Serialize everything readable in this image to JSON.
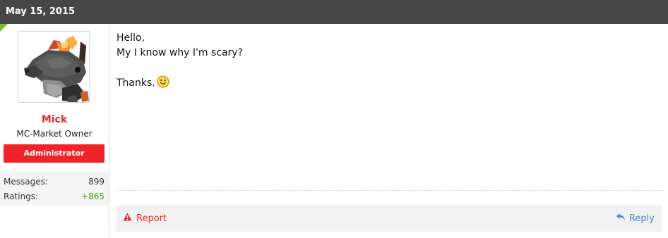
{
  "post": {
    "date": "May 15, 2015"
  },
  "user": {
    "name": "Mick",
    "title": "MC-Market Owner",
    "badge": "Administrator",
    "stats": [
      {
        "label": "Messages:",
        "value": "899"
      },
      {
        "label": "Ratings:",
        "value": "+865"
      }
    ]
  },
  "message": {
    "lines": [
      "Hello,",
      "My I know why I'm scary?",
      "",
      "Thanks."
    ],
    "emoji": "smile-icon"
  },
  "footer": {
    "report_label": "Report",
    "reply_label": "Reply"
  },
  "colors": {
    "header_bg": "#464646",
    "username": "#e82a2a",
    "badge_bg": "#f0232a",
    "positive": "#4e9a06",
    "reply_link": "#4a86c5"
  }
}
